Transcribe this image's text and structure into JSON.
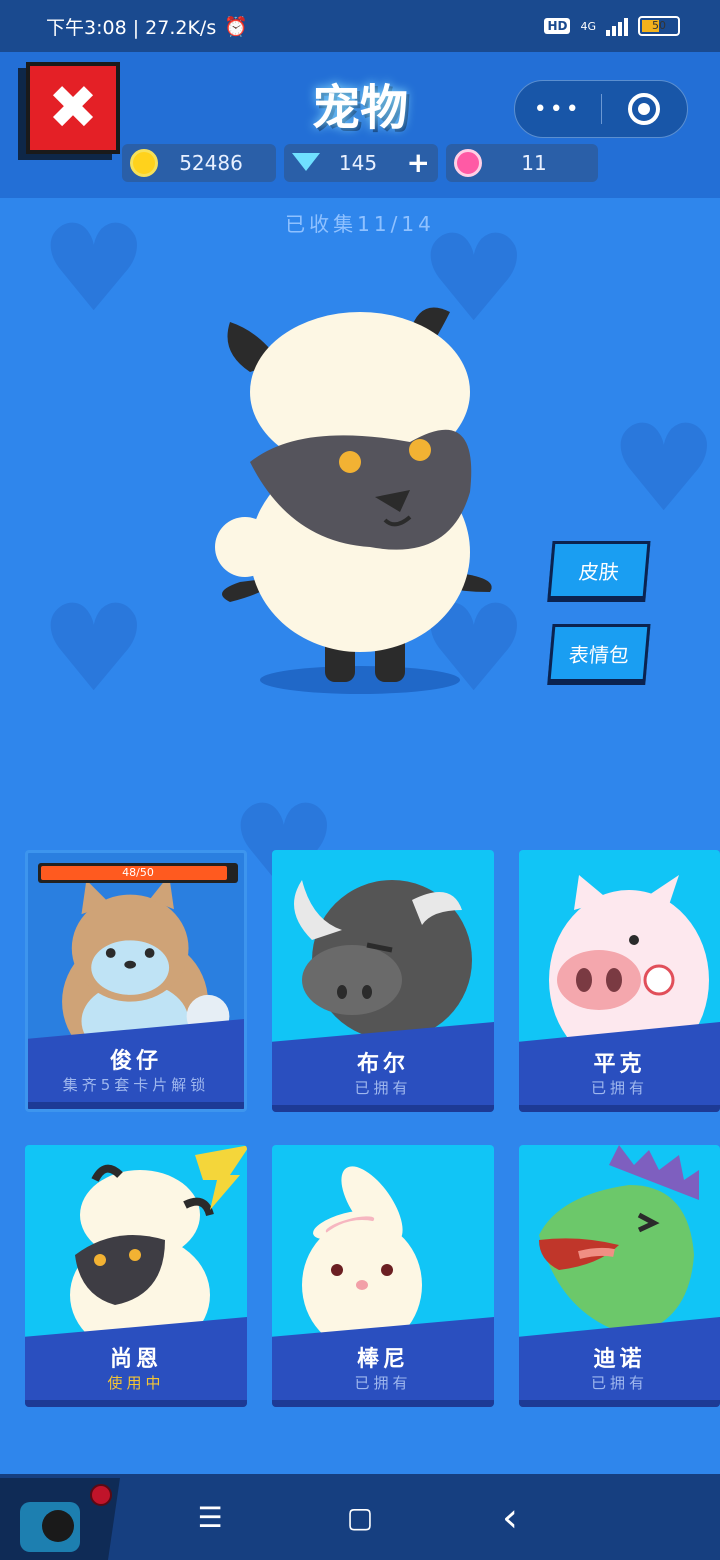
{
  "status_bar": {
    "time_speed": "下午3:08 | 27.2K/s",
    "network": "4G",
    "hd": "HD",
    "battery": "50"
  },
  "header": {
    "title": "宠物",
    "more_label": "•••"
  },
  "currencies": {
    "coins": "52486",
    "gems": "145",
    "flowers": "11"
  },
  "collected_text": "已收集11/14",
  "side_buttons": {
    "skin": "皮肤",
    "emoji": "表情包"
  },
  "pets": [
    {
      "name": "俊仔",
      "status": "集齐5套卡片解锁",
      "progress_text": "48/50",
      "progress_fraction": 0.96,
      "locked": true
    },
    {
      "name": "布尔",
      "status": "已拥有"
    },
    {
      "name": "平克",
      "status": "已拥有"
    },
    {
      "name": "尚恩",
      "status": "使用中",
      "active": true
    },
    {
      "name": "棒尼",
      "status": "已拥有"
    },
    {
      "name": "迪诺",
      "status": "已拥有"
    }
  ],
  "nav": {
    "menu": "☰",
    "home": "▢",
    "back": "‹"
  },
  "colors": {
    "background": "#2f86ec",
    "topbar": "#236fd6",
    "plate": "#2a4fbf",
    "active_status": "#f4c534",
    "close_red": "#e42026"
  }
}
